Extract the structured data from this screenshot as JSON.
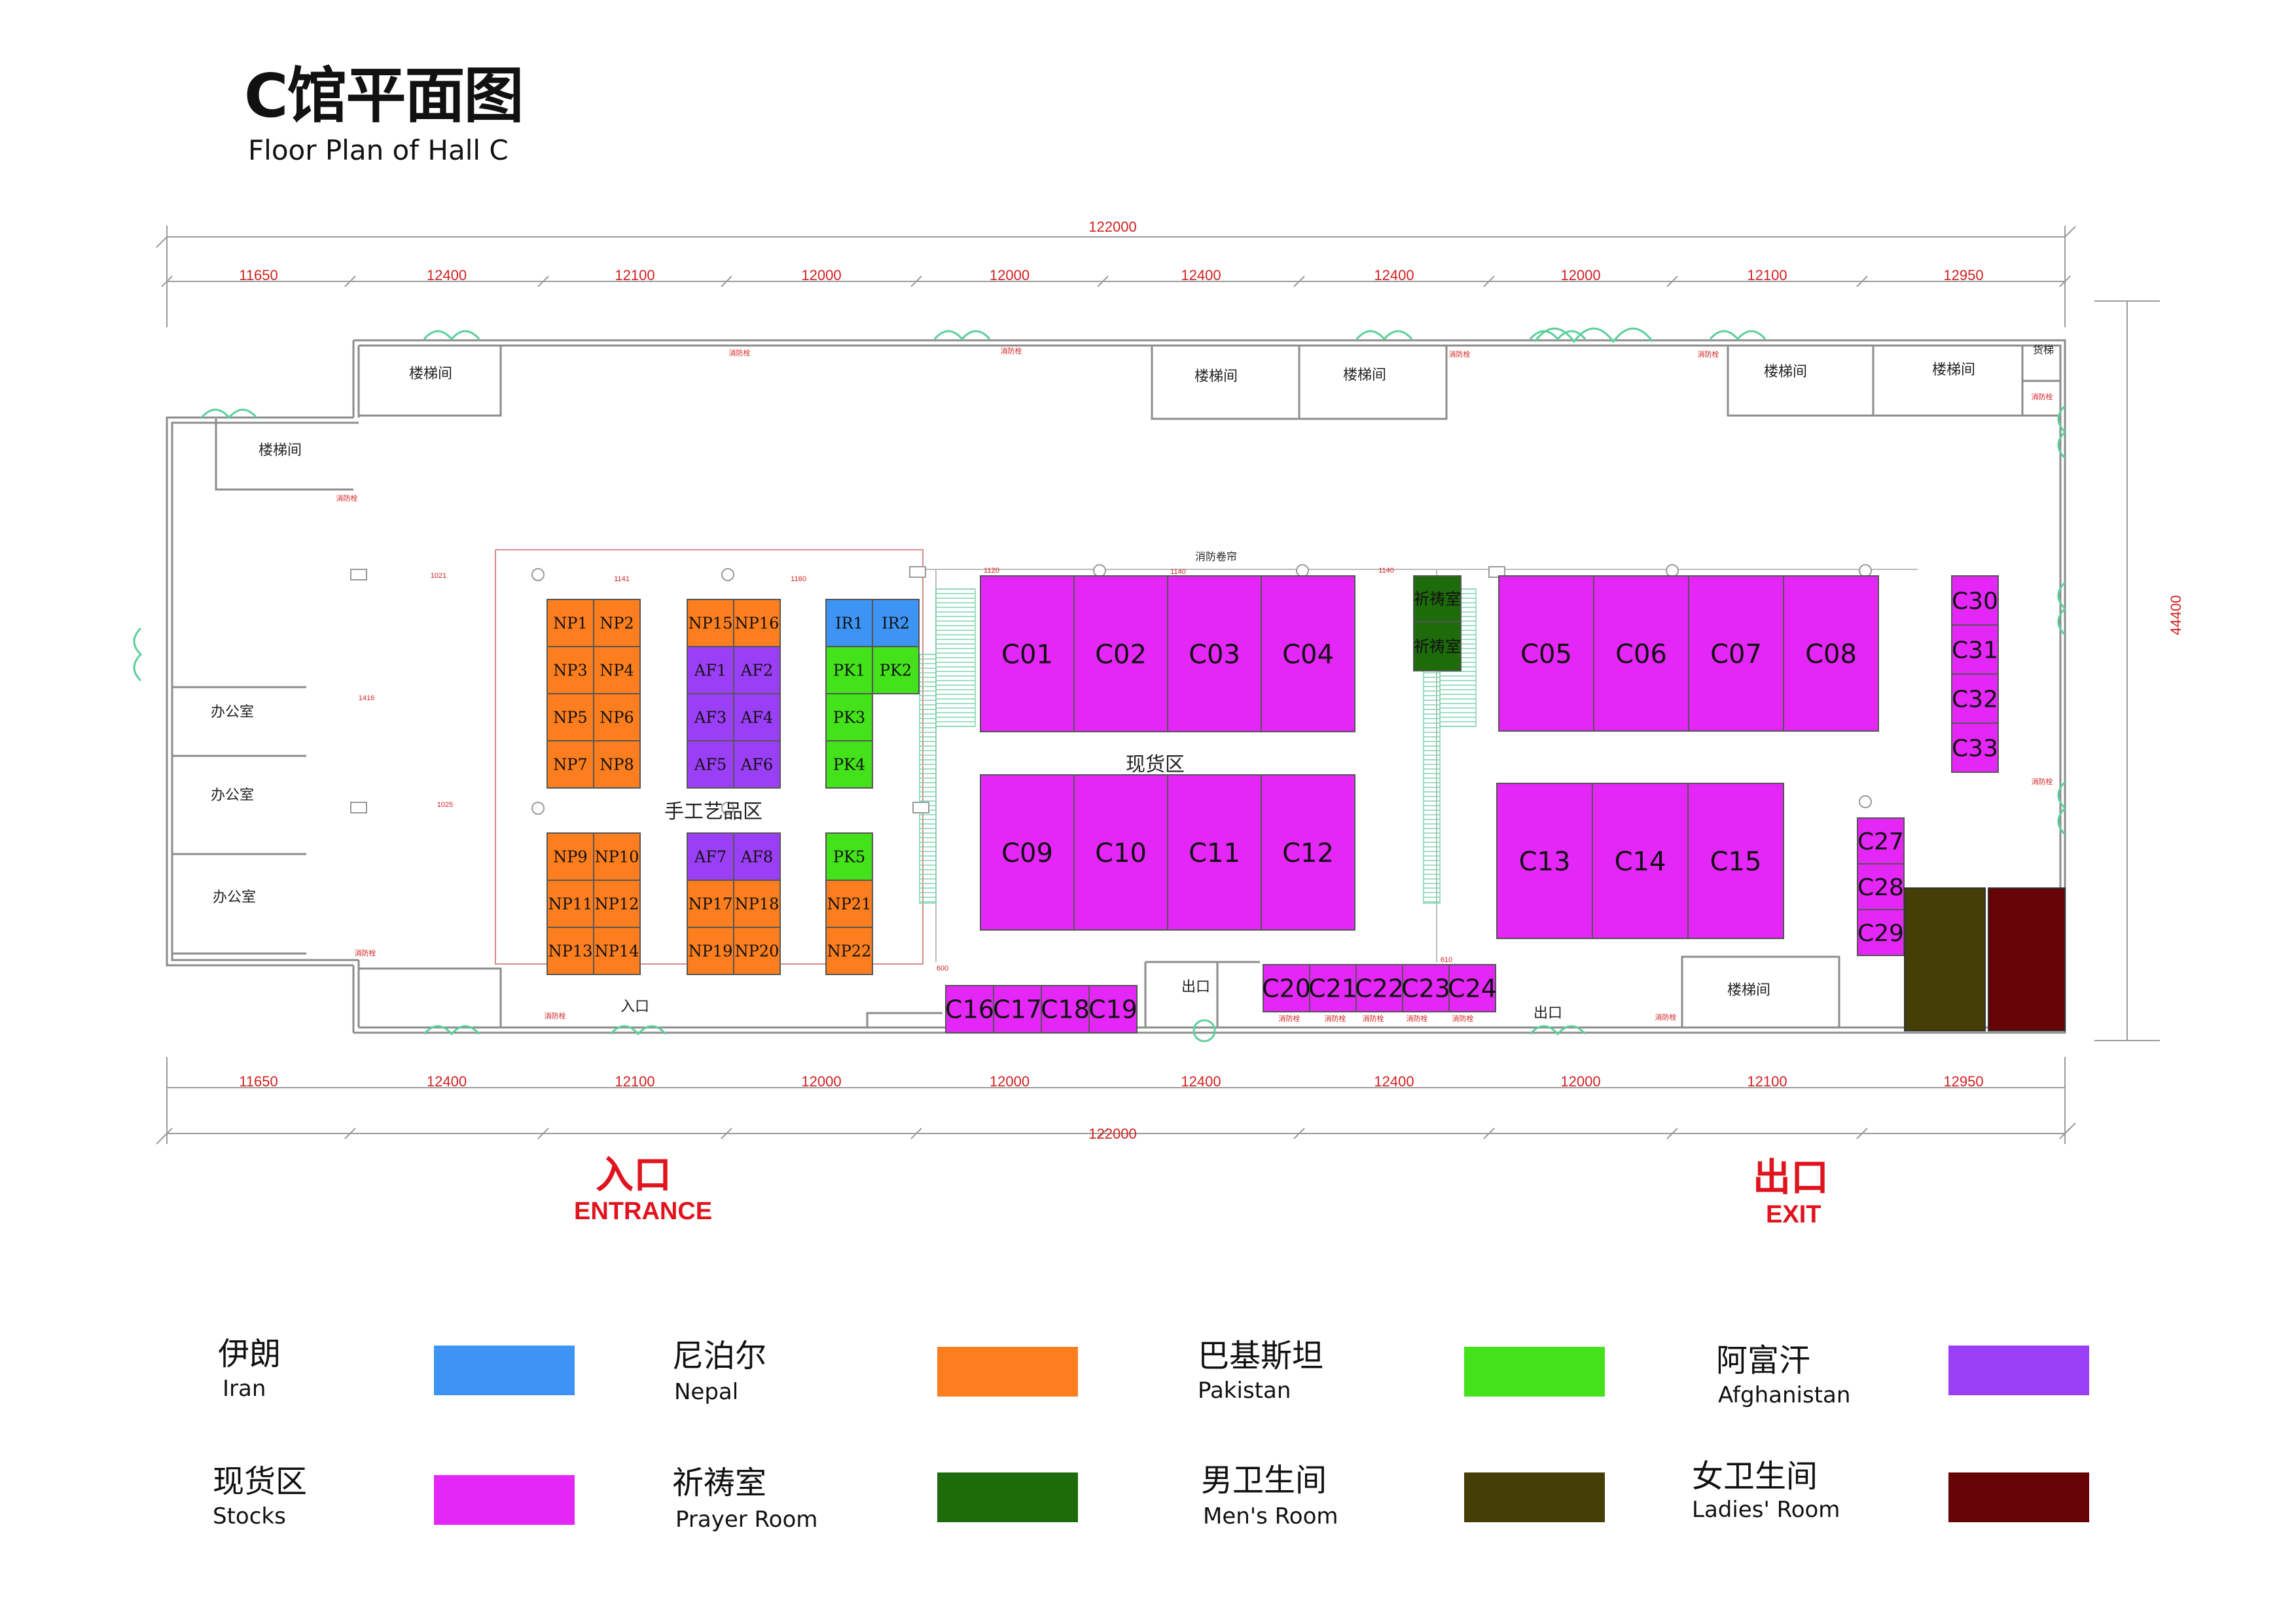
{
  "title": {
    "cn": "C馆平面图",
    "en": "Floor Plan of Hall C"
  },
  "dimensions": {
    "total": "122000",
    "depth": "44400",
    "segments": [
      "11650",
      "12400",
      "12100",
      "12000",
      "12000",
      "12400",
      "12400",
      "12000",
      "12100",
      "12950"
    ]
  },
  "rooms": {
    "stair": "楼梯间",
    "office": "办公室",
    "elevator": "货梯",
    "entry": "入口",
    "exit": "出口",
    "craft_area": "手工艺品区",
    "stock_area": "现货区",
    "fire_curtain": "消防卷帘",
    "fire_small": "消防卷帘",
    "prayer": "祈祷室",
    "hydrant": "消防栓",
    "small_dims": [
      "1141",
      "1160",
      "1021",
      "1416",
      "1025",
      "1120",
      "1140",
      "1140",
      "610",
      "600"
    ]
  },
  "colors": {
    "iran": "#3d94f5",
    "nepal": "#fd7e1e",
    "pakistan": "#44e21b",
    "afghanistan": "#9a3ff5",
    "stocks": "#e426f7",
    "prayer": "#1e6b0b",
    "mens": "#463e07",
    "ladies": "#650306",
    "wall": "#8c8c8c",
    "dim": "#d42020",
    "door": "#5ccf9c"
  },
  "booths": {
    "nepal": [
      "NP1",
      "NP2",
      "NP3",
      "NP4",
      "NP5",
      "NP6",
      "NP7",
      "NP8",
      "NP9",
      "NP10",
      "NP11",
      "NP12",
      "NP13",
      "NP14",
      "NP15",
      "NP16",
      "NP17",
      "NP18",
      "NP19",
      "NP20",
      "NP21",
      "NP22"
    ],
    "afghanistan": [
      "AF1",
      "AF2",
      "AF3",
      "AF4",
      "AF5",
      "AF6",
      "AF7",
      "AF8"
    ],
    "iran": [
      "IR1",
      "IR2"
    ],
    "pakistan": [
      "PK1",
      "PK2",
      "PK3",
      "PK4",
      "PK5"
    ],
    "stocks": [
      "C01",
      "C02",
      "C03",
      "C04",
      "C05",
      "C06",
      "C07",
      "C08",
      "C09",
      "C10",
      "C11",
      "C12",
      "C13",
      "C14",
      "C15",
      "C16",
      "C17",
      "C18",
      "C19",
      "C20",
      "C21",
      "C22",
      "C23",
      "C24",
      "C27",
      "C28",
      "C29",
      "C30",
      "C31",
      "C32",
      "C33"
    ],
    "prayer": [
      "祈祷室",
      "祈祷室"
    ]
  },
  "entrance": {
    "cn": "入口",
    "en": "ENTRANCE"
  },
  "exit": {
    "cn": "出口",
    "en": "EXIT"
  },
  "legend": [
    {
      "cn": "伊朗",
      "en": "Iran",
      "color": "#3d94f5"
    },
    {
      "cn": "尼泊尔",
      "en": "Nepal",
      "color": "#fd7e1e"
    },
    {
      "cn": "巴基斯坦",
      "en": "Pakistan",
      "color": "#44e21b"
    },
    {
      "cn": "阿富汗",
      "en": "Afghanistan",
      "color": "#9a3ff5"
    },
    {
      "cn": "现货区",
      "en": "Stocks",
      "color": "#e426f7"
    },
    {
      "cn": "祈祷室",
      "en": "Prayer Room",
      "color": "#1e6b0b"
    },
    {
      "cn": "男卫生间",
      "en": "Men's Room",
      "color": "#463e07"
    },
    {
      "cn": "女卫生间",
      "en": "Ladies' Room",
      "color": "#650306"
    }
  ]
}
